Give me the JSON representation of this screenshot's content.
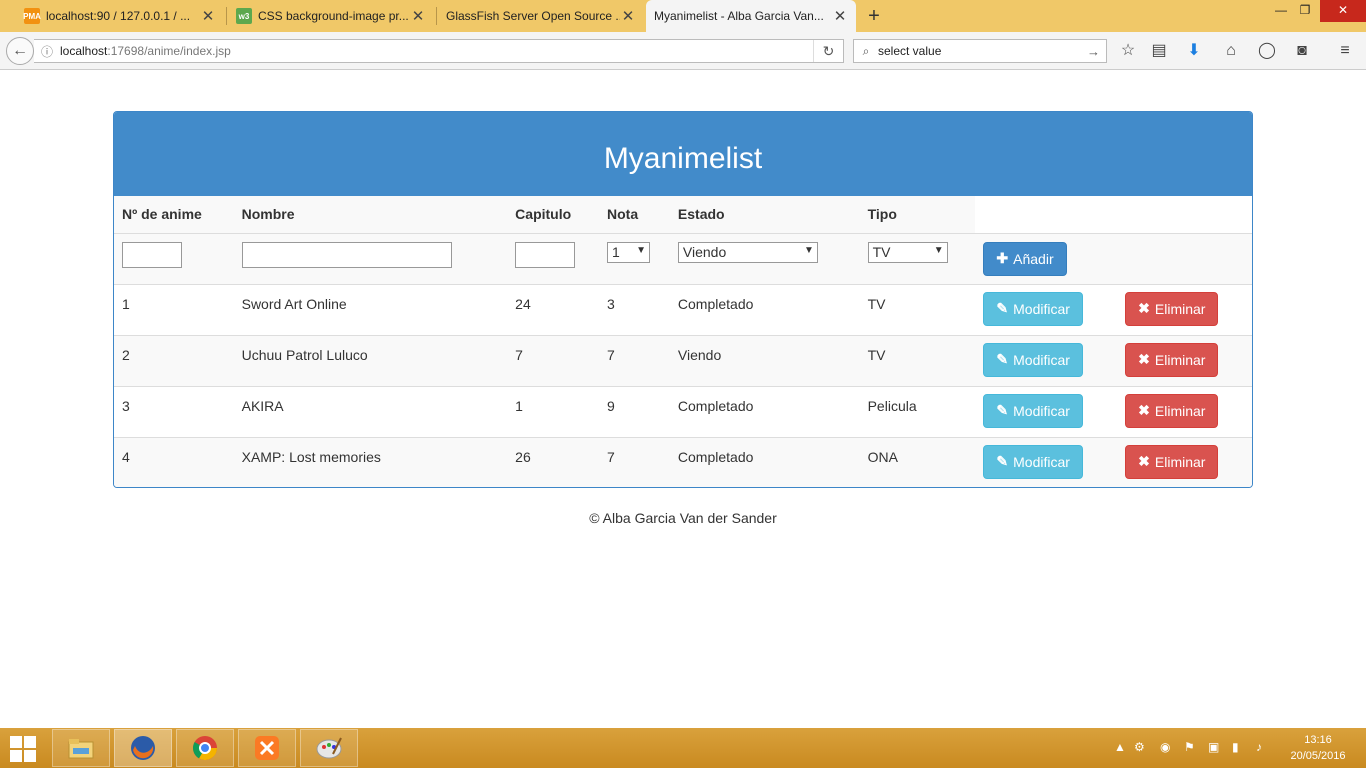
{
  "browser": {
    "tabs": [
      {
        "label": "localhost:90 / 127.0.0.1 / ...",
        "icon": "phpmyadmin-icon"
      },
      {
        "label": "CSS background-image pr...",
        "icon": "w3schools-icon"
      },
      {
        "label": "GlassFish Server Open Source ...",
        "icon": ""
      },
      {
        "label": "Myanimelist - Alba Garcia Van...",
        "icon": ""
      }
    ],
    "new_tab": "+",
    "url_host": "localhost",
    "url_path": ":17698/anime/index.jsp",
    "search_value": "select value"
  },
  "page": {
    "title": "Myanimelist",
    "columns": [
      "Nº de anime",
      "Nombre",
      "Capitulo",
      "Nota",
      "Estado",
      "Tipo"
    ],
    "form": {
      "nota_selected": "1",
      "estado_selected": "Viendo",
      "tipo_selected": "TV",
      "add_label": "Añadir"
    },
    "rows": [
      {
        "id": "1",
        "nombre": "Sword Art Online",
        "capitulo": "24",
        "nota": "3",
        "estado": "Completado",
        "tipo": "TV"
      },
      {
        "id": "2",
        "nombre": "Uchuu Patrol Luluco",
        "capitulo": "7",
        "nota": "7",
        "estado": "Viendo",
        "tipo": "TV"
      },
      {
        "id": "3",
        "nombre": "AKIRA",
        "capitulo": "1",
        "nota": "9",
        "estado": "Completado",
        "tipo": "Pelicula"
      },
      {
        "id": "4",
        "nombre": "XAMP: Lost memories",
        "capitulo": "26",
        "nota": "7",
        "estado": "Completado",
        "tipo": "ONA"
      }
    ],
    "modify_label": "Modificar",
    "delete_label": "Eliminar",
    "footer": "© Alba Garcia Van der Sander"
  },
  "taskbar": {
    "time": "13:16",
    "date": "20/05/2016"
  },
  "colors": {
    "primary": "#428bca",
    "info": "#5bc0de",
    "danger": "#d9534f",
    "tabbar": "#f0c868"
  }
}
